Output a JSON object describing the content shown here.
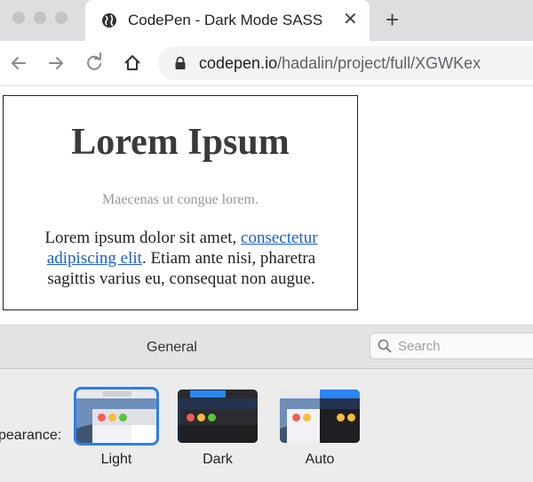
{
  "browser": {
    "tab_title": "CodePen - Dark Mode SASS",
    "tab_close": "✕",
    "new_tab": "+",
    "url_host": "codepen.io",
    "url_path": "/hadalin/project/full/XGWKex",
    "icons": [
      "globe-icon",
      "back-icon",
      "forward-icon",
      "reload-icon",
      "home-icon",
      "lock-icon"
    ]
  },
  "page": {
    "title": "Lorem Ipsum",
    "subtitle": "Maecenas ut congue lorem.",
    "body_before": "Lorem ipsum dolor sit amet, ",
    "body_link": "consectetur adipiscing elit",
    "body_after": ". Etiam ante nisi, pharetra sagittis varius eu, consequat non augue.",
    "link_color": "#1a5fd0"
  },
  "prefs": {
    "section_title": "General",
    "search_placeholder": "Search",
    "appearance_label": "pearance:",
    "options": [
      {
        "label": "Light",
        "selected": true
      },
      {
        "label": "Dark",
        "selected": false
      },
      {
        "label": "Auto",
        "selected": false
      }
    ],
    "accent": "#2a7ff0"
  }
}
